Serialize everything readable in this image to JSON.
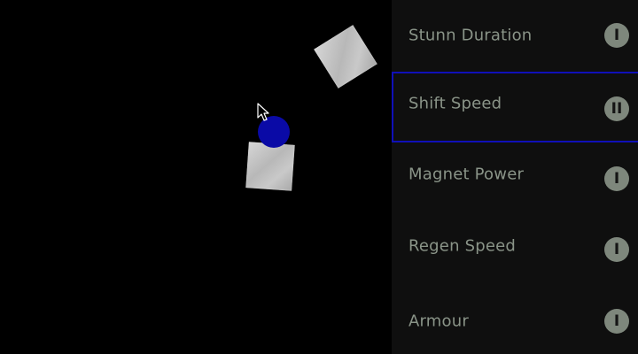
{
  "game": {
    "colors": {
      "background": "#000000",
      "panel": "#0f0f0f",
      "player": "#0a0aa6",
      "blocks": "#c4c4c4",
      "selection": "#1010b8",
      "text": "#8a9488"
    },
    "entities": {
      "player": "blue-orb",
      "blocks": [
        "metal-block",
        "metal-block"
      ]
    }
  },
  "upgrades": {
    "items": [
      {
        "label": "Stunn Duration",
        "level": "I",
        "selected": false
      },
      {
        "label": "Shift Speed",
        "level": "II",
        "selected": true
      },
      {
        "label": "Magnet Power",
        "level": "I",
        "selected": false
      },
      {
        "label": "Regen Speed",
        "level": "I",
        "selected": false
      },
      {
        "label": "Armour",
        "level": "I",
        "selected": false
      }
    ]
  }
}
